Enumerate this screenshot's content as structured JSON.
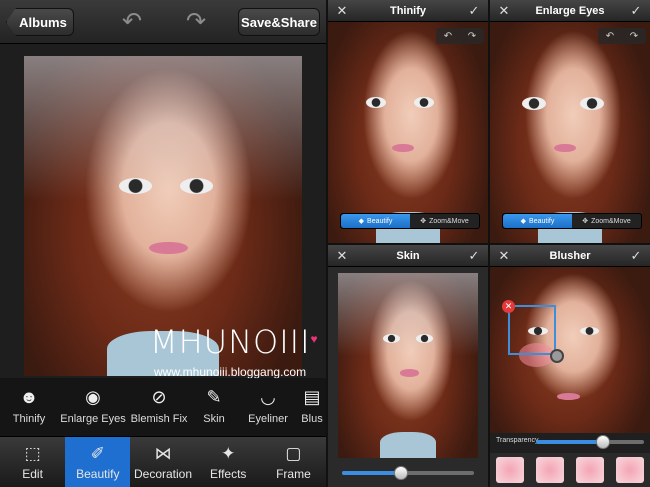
{
  "left": {
    "albums_label": "Albums",
    "save_label": "Save&Share",
    "watermark_logo": "MHUNOIII",
    "watermark_url": "www.mhunoiii.bloggang.com",
    "tools": [
      {
        "label": "Thinify",
        "icon": "face-icon"
      },
      {
        "label": "Enlarge Eyes",
        "icon": "eye-icon"
      },
      {
        "label": "Blemish Fix",
        "icon": "blemish-icon"
      },
      {
        "label": "Skin",
        "icon": "skin-icon"
      },
      {
        "label": "Eyeliner",
        "icon": "eyeliner-icon"
      },
      {
        "label": "Blus",
        "icon": "blusher-icon"
      }
    ],
    "tabs": [
      {
        "label": "Edit",
        "icon": "edit-icon"
      },
      {
        "label": "Beautify",
        "icon": "beautify-icon",
        "active": true
      },
      {
        "label": "Decoration",
        "icon": "bow-icon"
      },
      {
        "label": "Effects",
        "icon": "sparkle-icon"
      },
      {
        "label": "Frame",
        "icon": "frame-icon"
      }
    ]
  },
  "panels": {
    "thinify": {
      "title": "Thinify",
      "seg_beautify": "Beautify",
      "seg_zoom": "Zoom&Move"
    },
    "enlarge_eyes": {
      "title": "Enlarge Eyes",
      "seg_beautify": "Beautify",
      "seg_zoom": "Zoom&Move"
    },
    "skin": {
      "title": "Skin",
      "slider_value": 0.45
    },
    "blusher": {
      "title": "Blusher",
      "transparency_label": "Transparency",
      "transparency_value": 0.62
    }
  },
  "colors": {
    "accent": "#1f6fd1",
    "toolbar_dark": "#232323",
    "blush_pink": "#f4a5b4",
    "watermark_heart": "#e8357a"
  }
}
